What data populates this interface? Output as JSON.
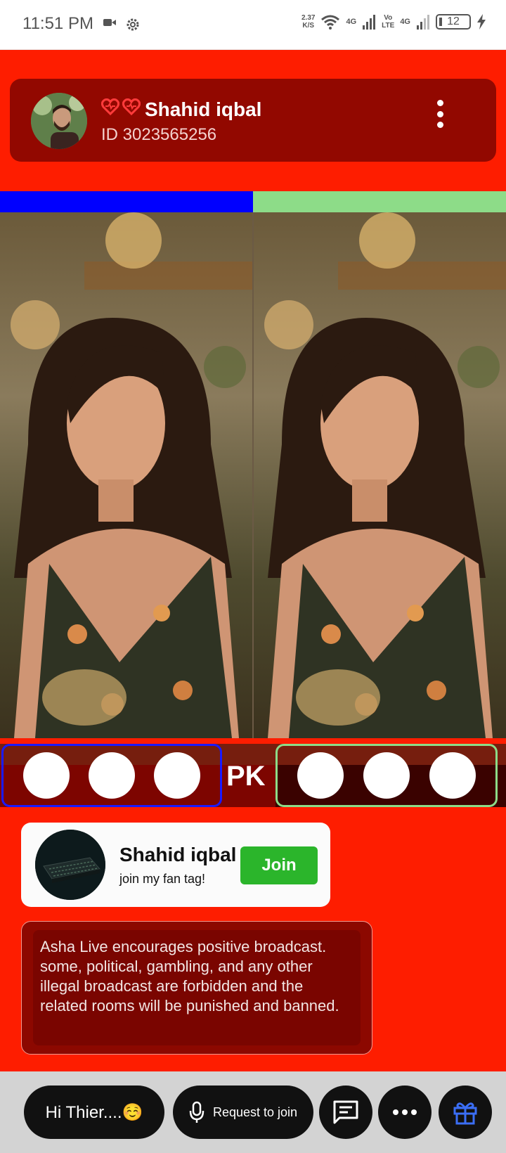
{
  "status_bar": {
    "time": "11:51 PM",
    "speed_value": "2.37",
    "speed_unit": "K/S",
    "net1": "4G",
    "volte_top": "Vo",
    "volte_bottom": "LTE",
    "net2": "4G",
    "battery": "12",
    "icons": [
      "video-camera-icon",
      "gear-icon",
      "wifi-icon",
      "signal-icon",
      "signal-icon",
      "battery-icon",
      "charging-icon"
    ]
  },
  "host": {
    "name": "Shahid iqbal",
    "id_text": "ID 3023565256",
    "badges": [
      "heart-badge-icon",
      "heart-badge-icon"
    ]
  },
  "teams": {
    "left_color": "#0000ff",
    "right_color": "#8ddc88"
  },
  "pk": {
    "label": "PK"
  },
  "fan_tag": {
    "name": "Shahid iqbal",
    "subtitle": "join my fan tag!",
    "button": "Join"
  },
  "notice": {
    "text": "Asha Live encourages positive broadcast. some, political, gambling, and any other illegal broadcast are forbidden and the related rooms will be punished and banned."
  },
  "bottom_bar": {
    "chat_text": "Hi Thier....☺️",
    "request_label": "Request to join",
    "icons": [
      "microphone-icon",
      "message-icon",
      "more-icon",
      "gift-icon"
    ]
  },
  "colors": {
    "background": "#fe1d00",
    "host_card": "#920800",
    "join_button": "#2bb52b"
  }
}
